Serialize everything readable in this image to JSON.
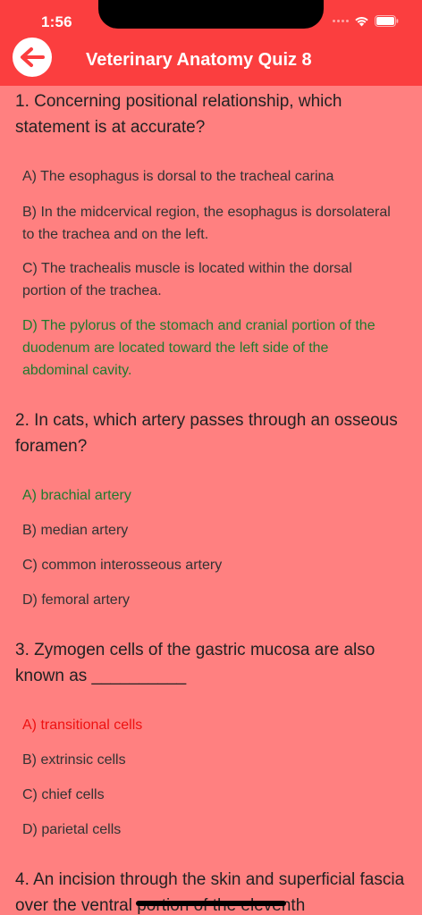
{
  "status": {
    "time": "1:56"
  },
  "header": {
    "title": "Veterinary Anatomy Quiz 8"
  },
  "colors": {
    "header_bg": "#fb3e3f",
    "page_bg": "#ff8080",
    "correct": "#1f7a2e",
    "wrong": "#ee1111"
  },
  "questions": [
    {
      "text": "1. Concerning positional relationship, which statement is at accurate?",
      "options": [
        {
          "label": "A) The esophagus is dorsal to the tracheal carina",
          "state": "normal"
        },
        {
          "label": "B) In the midcervical region, the esophagus is dorsolateral to the trachea and on the left.",
          "state": "normal"
        },
        {
          "label": "C) The trachealis muscle is located within the dorsal portion of the trachea.",
          "state": "normal"
        },
        {
          "label": "D) The pylorus of the stomach and cranial portion of the duodenum are located toward the left side of the abdominal cavity.",
          "state": "correct"
        }
      ]
    },
    {
      "text": "2. In cats, which artery passes through an osseous foramen?",
      "options": [
        {
          "label": "A) brachial artery",
          "state": "correct"
        },
        {
          "label": "B) median artery",
          "state": "normal"
        },
        {
          "label": "C) common interosseous artery",
          "state": "normal"
        },
        {
          "label": "D) femoral artery",
          "state": "normal"
        }
      ]
    },
    {
      "text": "3. Zymogen cells of the gastric mucosa are also known as __________",
      "options": [
        {
          "label": "A) transitional cells",
          "state": "wrong"
        },
        {
          "label": "B) extrinsic cells",
          "state": "normal"
        },
        {
          "label": "C) chief cells",
          "state": "normal"
        },
        {
          "label": "D) parietal cells",
          "state": "normal"
        }
      ]
    },
    {
      "text": "4. An incision through the skin and superficial fascia over the ventral portion of the eleventh"
    }
  ]
}
